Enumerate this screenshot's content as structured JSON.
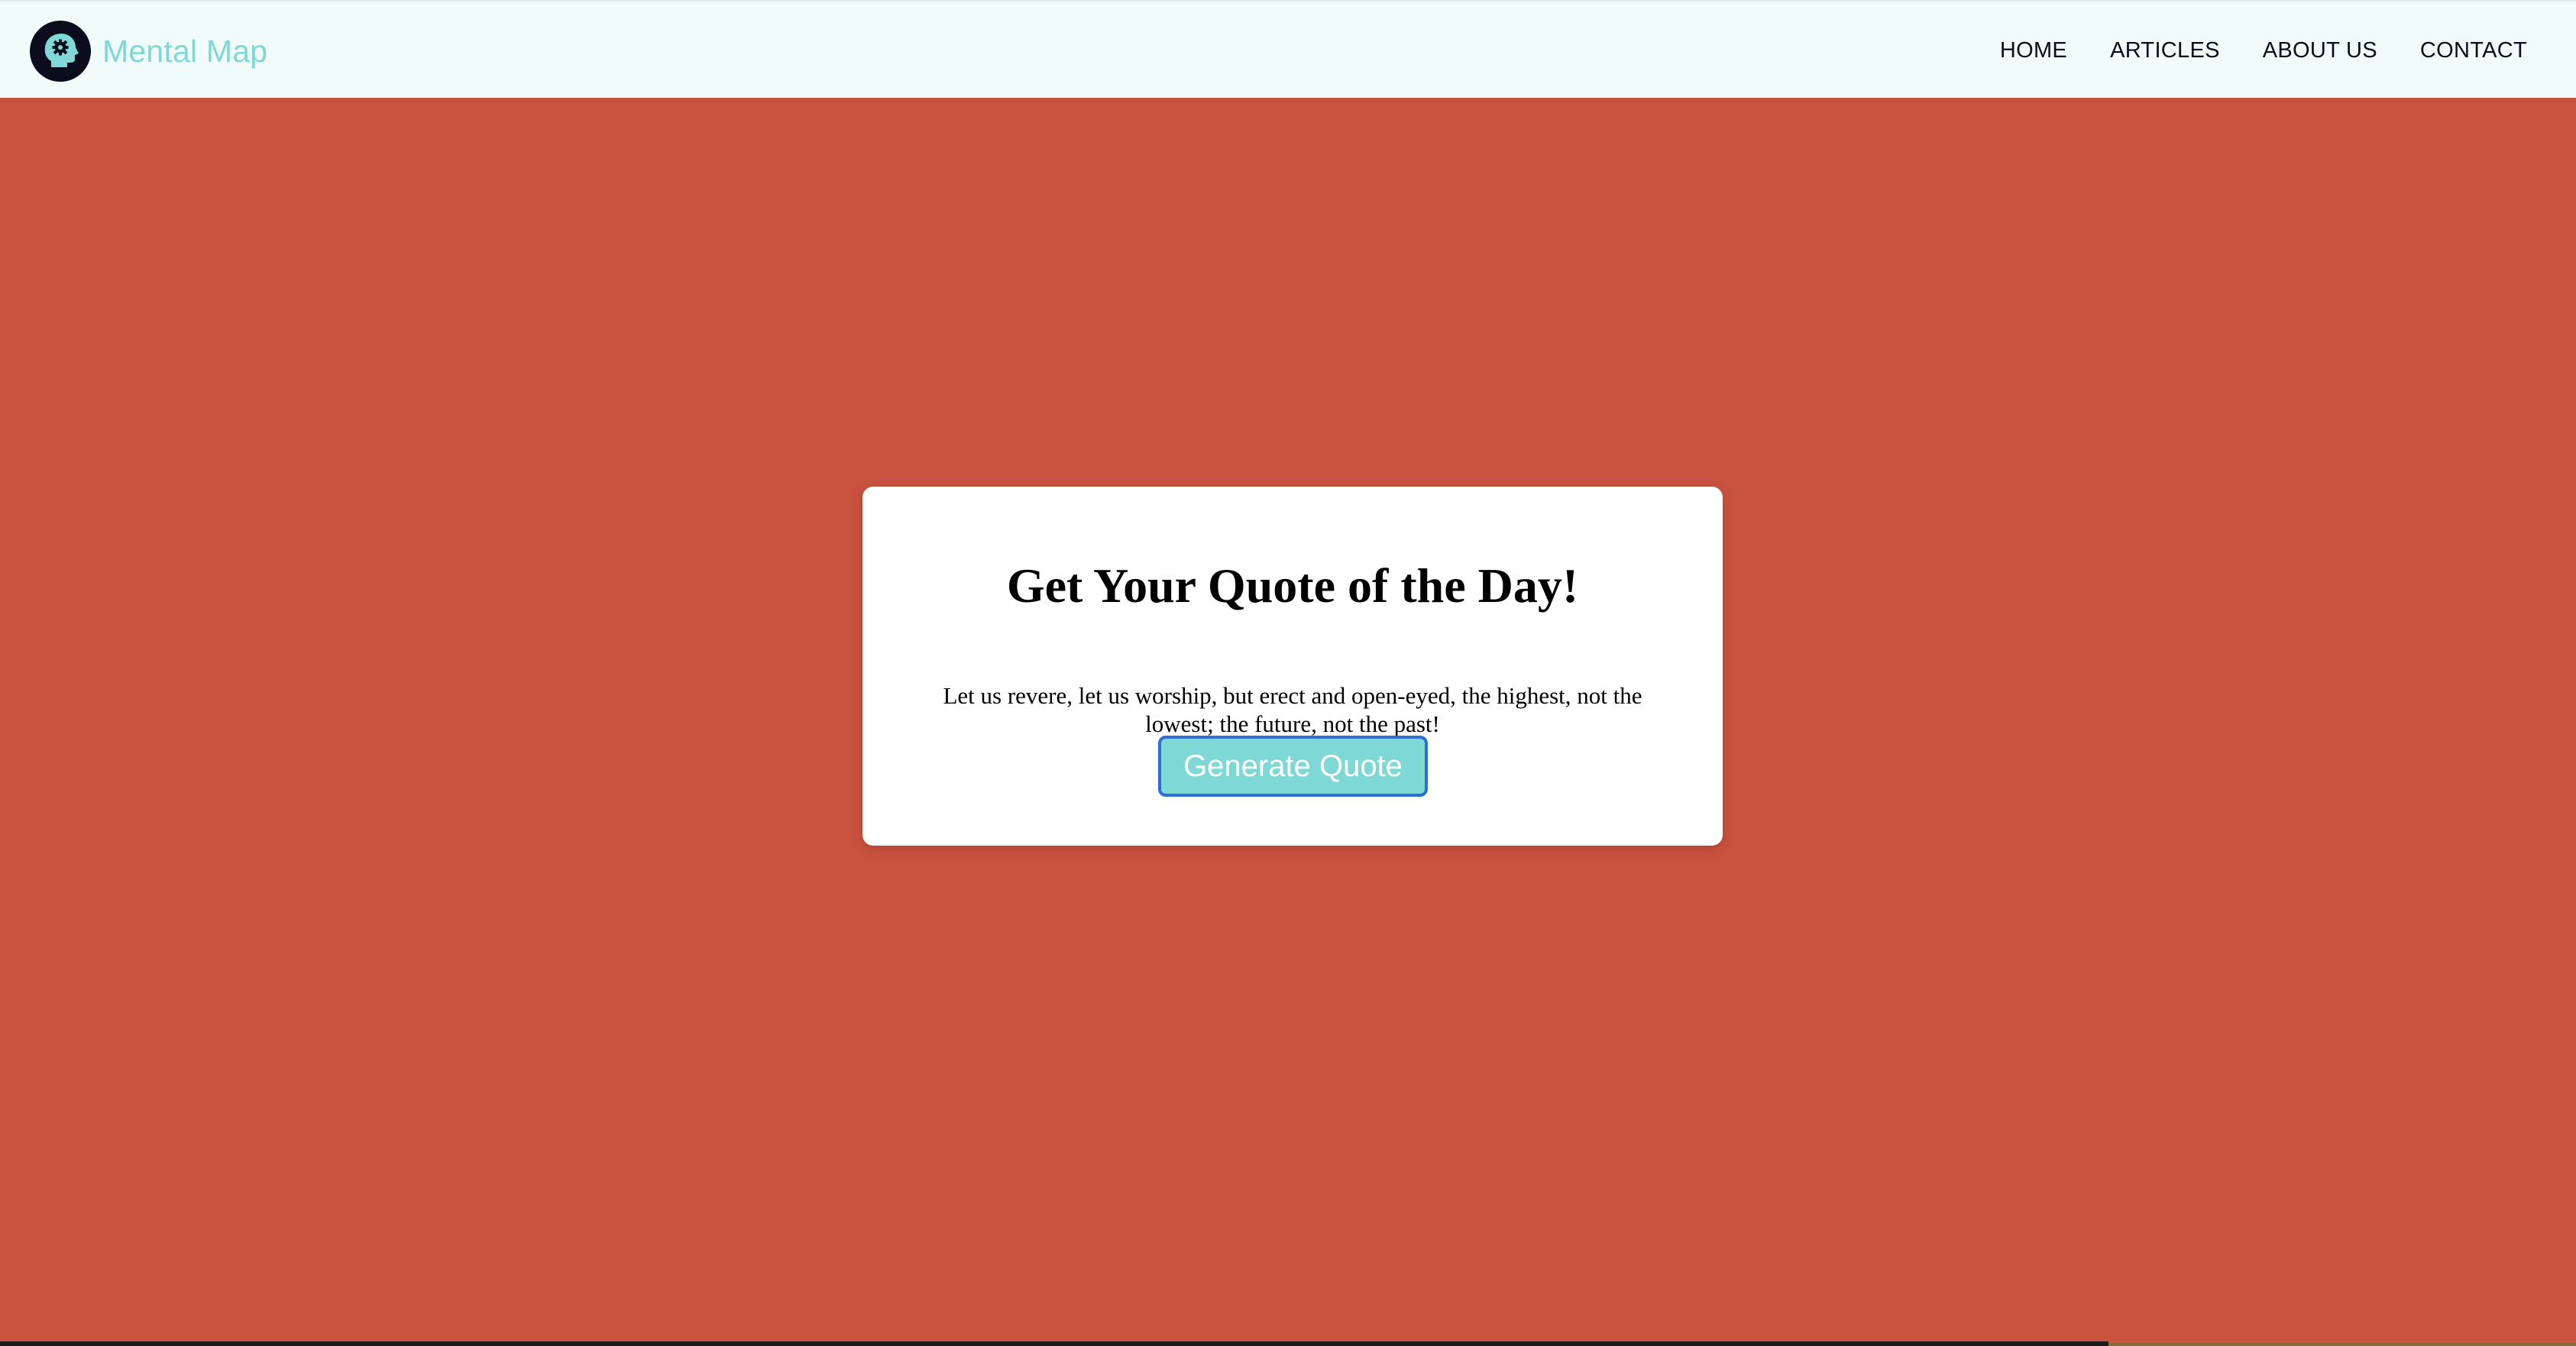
{
  "header": {
    "brand_name": "Mental Map",
    "nav": [
      {
        "label": "HOME"
      },
      {
        "label": "ARTICLES"
      },
      {
        "label": "ABOUT US"
      },
      {
        "label": "CONTACT"
      }
    ]
  },
  "card": {
    "title": "Get Your Quote of the Day!",
    "quote": "Let us revere, let us worship, but erect and open-eyed, the highest, not the lowest; the future, not the past!",
    "button_label": "Generate Quote"
  },
  "icons": {
    "logo": "head-with-gear-icon"
  },
  "colors": {
    "page_background": "#ca5340",
    "header_background": "#f0fbfa",
    "brand_accent": "#7fd8d6",
    "logo_circle": "#0b0d1f",
    "button_background": "#7ed9d6",
    "button_border": "#2f6fd3",
    "card_background": "#ffffff"
  }
}
